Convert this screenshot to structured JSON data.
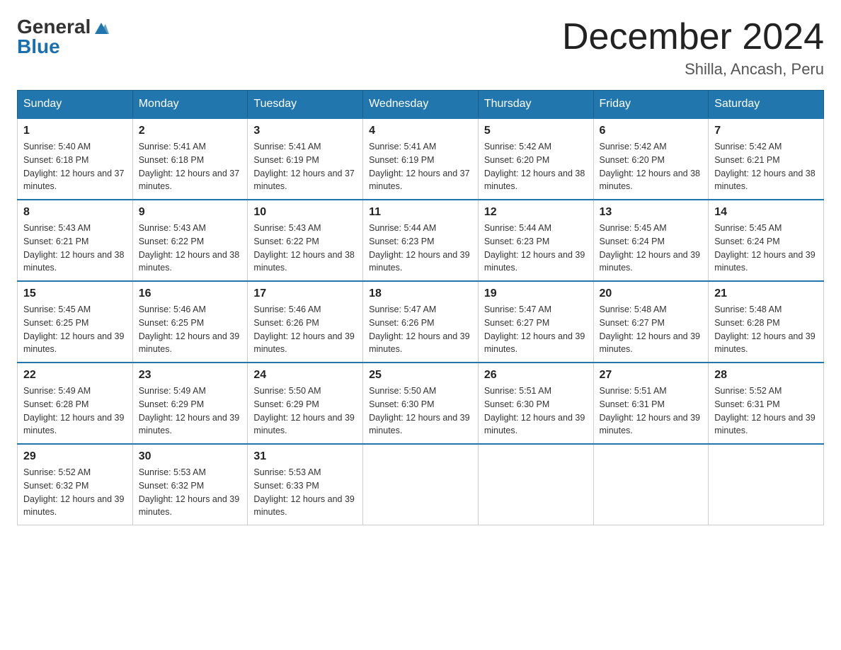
{
  "header": {
    "title": "December 2024",
    "location": "Shilla, Ancash, Peru",
    "logo_general": "General",
    "logo_blue": "Blue"
  },
  "days_of_week": [
    "Sunday",
    "Monday",
    "Tuesday",
    "Wednesday",
    "Thursday",
    "Friday",
    "Saturday"
  ],
  "weeks": [
    [
      {
        "day": "1",
        "sunrise": "5:40 AM",
        "sunset": "6:18 PM",
        "daylight": "12 hours and 37 minutes."
      },
      {
        "day": "2",
        "sunrise": "5:41 AM",
        "sunset": "6:18 PM",
        "daylight": "12 hours and 37 minutes."
      },
      {
        "day": "3",
        "sunrise": "5:41 AM",
        "sunset": "6:19 PM",
        "daylight": "12 hours and 37 minutes."
      },
      {
        "day": "4",
        "sunrise": "5:41 AM",
        "sunset": "6:19 PM",
        "daylight": "12 hours and 37 minutes."
      },
      {
        "day": "5",
        "sunrise": "5:42 AM",
        "sunset": "6:20 PM",
        "daylight": "12 hours and 38 minutes."
      },
      {
        "day": "6",
        "sunrise": "5:42 AM",
        "sunset": "6:20 PM",
        "daylight": "12 hours and 38 minutes."
      },
      {
        "day": "7",
        "sunrise": "5:42 AM",
        "sunset": "6:21 PM",
        "daylight": "12 hours and 38 minutes."
      }
    ],
    [
      {
        "day": "8",
        "sunrise": "5:43 AM",
        "sunset": "6:21 PM",
        "daylight": "12 hours and 38 minutes."
      },
      {
        "day": "9",
        "sunrise": "5:43 AM",
        "sunset": "6:22 PM",
        "daylight": "12 hours and 38 minutes."
      },
      {
        "day": "10",
        "sunrise": "5:43 AM",
        "sunset": "6:22 PM",
        "daylight": "12 hours and 38 minutes."
      },
      {
        "day": "11",
        "sunrise": "5:44 AM",
        "sunset": "6:23 PM",
        "daylight": "12 hours and 39 minutes."
      },
      {
        "day": "12",
        "sunrise": "5:44 AM",
        "sunset": "6:23 PM",
        "daylight": "12 hours and 39 minutes."
      },
      {
        "day": "13",
        "sunrise": "5:45 AM",
        "sunset": "6:24 PM",
        "daylight": "12 hours and 39 minutes."
      },
      {
        "day": "14",
        "sunrise": "5:45 AM",
        "sunset": "6:24 PM",
        "daylight": "12 hours and 39 minutes."
      }
    ],
    [
      {
        "day": "15",
        "sunrise": "5:45 AM",
        "sunset": "6:25 PM",
        "daylight": "12 hours and 39 minutes."
      },
      {
        "day": "16",
        "sunrise": "5:46 AM",
        "sunset": "6:25 PM",
        "daylight": "12 hours and 39 minutes."
      },
      {
        "day": "17",
        "sunrise": "5:46 AM",
        "sunset": "6:26 PM",
        "daylight": "12 hours and 39 minutes."
      },
      {
        "day": "18",
        "sunrise": "5:47 AM",
        "sunset": "6:26 PM",
        "daylight": "12 hours and 39 minutes."
      },
      {
        "day": "19",
        "sunrise": "5:47 AM",
        "sunset": "6:27 PM",
        "daylight": "12 hours and 39 minutes."
      },
      {
        "day": "20",
        "sunrise": "5:48 AM",
        "sunset": "6:27 PM",
        "daylight": "12 hours and 39 minutes."
      },
      {
        "day": "21",
        "sunrise": "5:48 AM",
        "sunset": "6:28 PM",
        "daylight": "12 hours and 39 minutes."
      }
    ],
    [
      {
        "day": "22",
        "sunrise": "5:49 AM",
        "sunset": "6:28 PM",
        "daylight": "12 hours and 39 minutes."
      },
      {
        "day": "23",
        "sunrise": "5:49 AM",
        "sunset": "6:29 PM",
        "daylight": "12 hours and 39 minutes."
      },
      {
        "day": "24",
        "sunrise": "5:50 AM",
        "sunset": "6:29 PM",
        "daylight": "12 hours and 39 minutes."
      },
      {
        "day": "25",
        "sunrise": "5:50 AM",
        "sunset": "6:30 PM",
        "daylight": "12 hours and 39 minutes."
      },
      {
        "day": "26",
        "sunrise": "5:51 AM",
        "sunset": "6:30 PM",
        "daylight": "12 hours and 39 minutes."
      },
      {
        "day": "27",
        "sunrise": "5:51 AM",
        "sunset": "6:31 PM",
        "daylight": "12 hours and 39 minutes."
      },
      {
        "day": "28",
        "sunrise": "5:52 AM",
        "sunset": "6:31 PM",
        "daylight": "12 hours and 39 minutes."
      }
    ],
    [
      {
        "day": "29",
        "sunrise": "5:52 AM",
        "sunset": "6:32 PM",
        "daylight": "12 hours and 39 minutes."
      },
      {
        "day": "30",
        "sunrise": "5:53 AM",
        "sunset": "6:32 PM",
        "daylight": "12 hours and 39 minutes."
      },
      {
        "day": "31",
        "sunrise": "5:53 AM",
        "sunset": "6:33 PM",
        "daylight": "12 hours and 39 minutes."
      },
      null,
      null,
      null,
      null
    ]
  ]
}
